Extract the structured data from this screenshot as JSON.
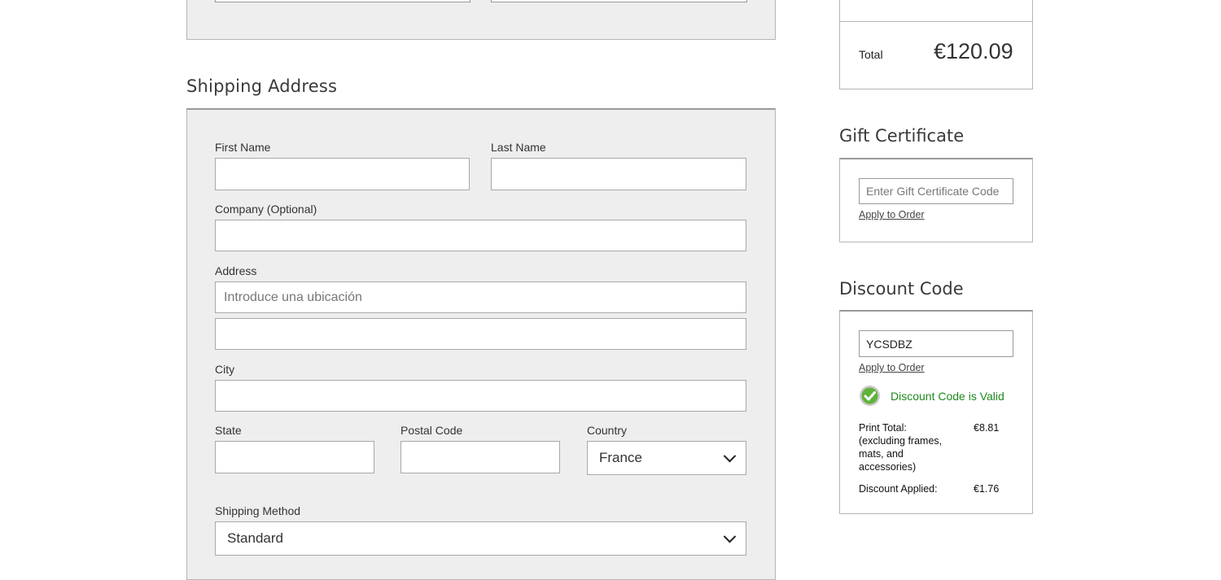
{
  "shipping": {
    "title": "Shipping Address",
    "first_name_label": "First Name",
    "last_name_label": "Last Name",
    "company_label": "Company (Optional)",
    "address_label": "Address",
    "address_placeholder": "Introduce una ubicación",
    "city_label": "City",
    "state_label": "State",
    "postal_label": "Postal Code",
    "country_label": "Country",
    "country_value": "France",
    "method_label": "Shipping Method",
    "method_value": "Standard"
  },
  "summary": {
    "total_label": "Total",
    "total_value": "€120.09"
  },
  "gift": {
    "title": "Gift Certificate",
    "placeholder": "Enter Gift Certificate Code",
    "apply": "Apply to Order"
  },
  "discount": {
    "title": "Discount Code",
    "code": "YCSDBZ",
    "apply": "Apply to Order",
    "valid_msg": "Discount Code is Valid",
    "print_total_label": "Print Total:",
    "print_total_note": "(excluding frames, mats, and accessories)",
    "print_total_value": "€8.81",
    "applied_label": "Discount Applied:",
    "applied_value": "€1.76"
  },
  "colors": {
    "valid_green": "#1e8a1e",
    "panel_bg": "#eeeeee"
  },
  "icons": {
    "valid": "check-circle-icon",
    "dropdown": "chevron-down-icon"
  }
}
